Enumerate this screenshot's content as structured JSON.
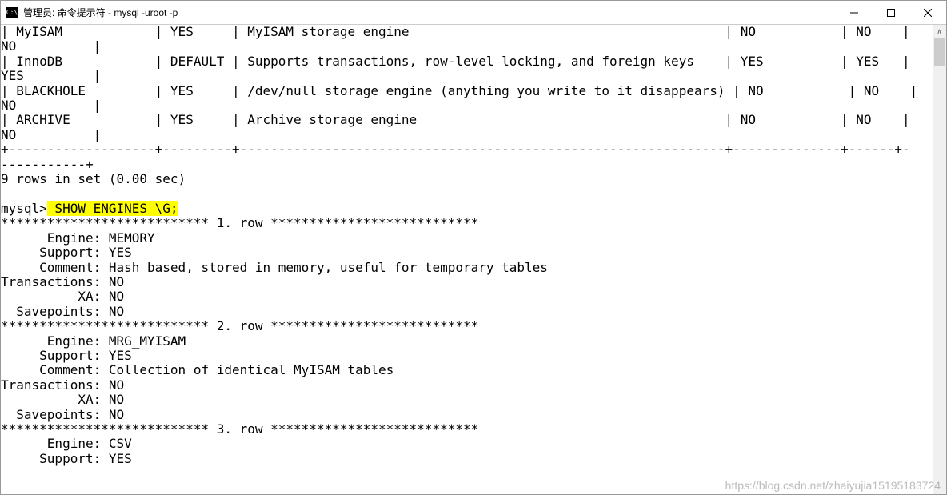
{
  "window": {
    "title": "管理员: 命令提示符 - mysql  -uroot -p"
  },
  "table_rows": [
    {
      "engine": "MyISAM",
      "support": "YES",
      "comment": "MyISAM storage engine",
      "col4": "NO",
      "col5": "NO",
      "wrap": "NO"
    },
    {
      "engine": "InnoDB",
      "support": "DEFAULT",
      "comment": "Supports transactions, row-level locking, and foreign keys",
      "col4": "YES",
      "col5": "YES",
      "wrap": "YES"
    },
    {
      "engine": "BLACKHOLE",
      "support": "YES",
      "comment": "/dev/null storage engine (anything you write to it disappears)",
      "col4": "NO",
      "col5": "NO",
      "wrap": "NO"
    },
    {
      "engine": "ARCHIVE",
      "support": "YES",
      "comment": "Archive storage engine",
      "col4": "NO",
      "col5": "NO",
      "wrap": "NO"
    }
  ],
  "ruler1": "+-------------------+---------+---------------------------------------------------------------+--------------+------+-",
  "ruler2": "-----------+",
  "summary": "9 rows in set (0.00 sec)",
  "prompt": "mysql>",
  "command": " SHOW ENGINES \\G;",
  "row_header": {
    "prefix": "***************************",
    "suffix": "***************************"
  },
  "vrows": [
    {
      "n": "1. row",
      "fields": {
        "Engine": "MEMORY",
        "Support": "YES",
        "Comment": "Hash based, stored in memory, useful for temporary tables",
        "Transactions": "NO",
        "XA": "NO",
        "Savepoints": "NO"
      }
    },
    {
      "n": "2. row",
      "fields": {
        "Engine": "MRG_MYISAM",
        "Support": "YES",
        "Comment": "Collection of identical MyISAM tables",
        "Transactions": "NO",
        "XA": "NO",
        "Savepoints": "NO"
      }
    },
    {
      "n": "3. row",
      "fields": {
        "Engine": "CSV",
        "Support": "YES"
      }
    }
  ],
  "watermark": "https://blog.csdn.net/zhaiyujia15195183724"
}
